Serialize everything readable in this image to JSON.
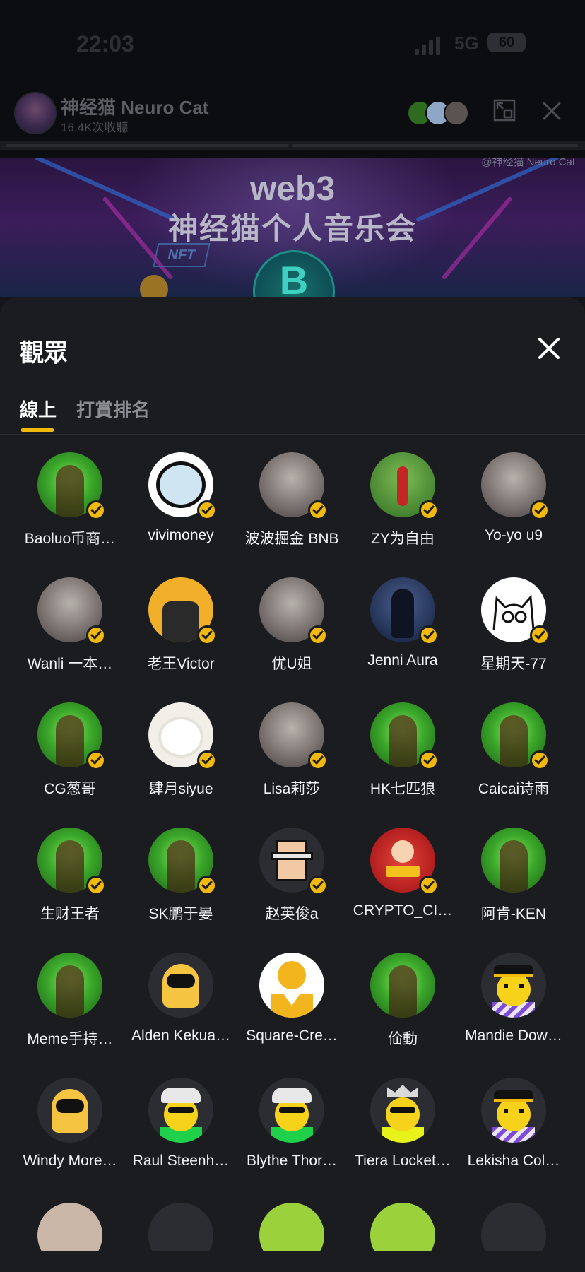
{
  "status_bar": {
    "time": "22:03",
    "network": "5G",
    "battery": "60"
  },
  "room": {
    "title": "神经猫 Neuro Cat",
    "subtitle": "16.4K次收聽",
    "banner_line1": "web3",
    "banner_line2": "神经猫个人音乐会",
    "banner_watermark": "@神经猫 Neuro Cat",
    "banner_badge": "NFT",
    "banner_coin": "B"
  },
  "sheet": {
    "title": "觀眾",
    "tabs": [
      {
        "label": "線上",
        "active": true
      },
      {
        "label": "打賞排名",
        "active": false
      }
    ],
    "accent_color": "#f0b90b"
  },
  "audience": [
    {
      "name": "Baoluo币商…",
      "avatar": "hood-avatar",
      "verified": true
    },
    {
      "name": "vivimoney",
      "avatar": "white-dog-avatar",
      "verified": true
    },
    {
      "name": "波波掘金 BNB",
      "avatar": "photo-avatar",
      "verified": true
    },
    {
      "name": "ZY为自由",
      "avatar": "football-avatar",
      "verified": true
    },
    {
      "name": "Yo-yo u9",
      "avatar": "photo-avatar",
      "verified": true
    },
    {
      "name": "Wanli 一本…",
      "avatar": "photo-avatar",
      "verified": true
    },
    {
      "name": "老王Victor",
      "avatar": "bnb-chain-avatar",
      "verified": true
    },
    {
      "name": "优U姐",
      "avatar": "photo-avatar",
      "verified": true
    },
    {
      "name": "Jenni Aura",
      "avatar": "cyber-girl-avatar",
      "verified": true
    },
    {
      "name": "星期天-77",
      "avatar": "cat-doodle-avatar",
      "verified": true
    },
    {
      "name": "CG葱哥",
      "avatar": "hood-avatar",
      "verified": true
    },
    {
      "name": "肆月siyue",
      "avatar": "white-cat-avatar",
      "verified": true
    },
    {
      "name": "Lisa莉莎",
      "avatar": "photo-avatar",
      "verified": true
    },
    {
      "name": "HK七匹狼",
      "avatar": "hood-avatar",
      "verified": true
    },
    {
      "name": "Caicai诗雨",
      "avatar": "hood-avatar",
      "verified": true
    },
    {
      "name": "生财王者",
      "avatar": "hood-avatar",
      "verified": true
    },
    {
      "name": "SK鹏于晏",
      "avatar": "hood-avatar",
      "verified": true
    },
    {
      "name": "赵英俊a",
      "avatar": "pixel-punk-avatar",
      "verified": true
    },
    {
      "name": "CRYPTO_CI…",
      "avatar": "crypto-citizen-avatar",
      "verified": true
    },
    {
      "name": "阿肯-KEN",
      "avatar": "hood-avatar",
      "verified": false
    },
    {
      "name": "Meme手持…",
      "avatar": "hood-avatar",
      "verified": false
    },
    {
      "name": "Alden Kekua…",
      "avatar": "astronaut-avatar",
      "verified": false
    },
    {
      "name": "Square-Cre…",
      "avatar": "square-creator-avatar",
      "verified": false
    },
    {
      "name": "佡動",
      "avatar": "hood-avatar",
      "verified": false
    },
    {
      "name": "Mandie Dow…",
      "avatar": "smiley-hat-avatar",
      "verified": false
    },
    {
      "name": "Windy More…",
      "avatar": "astronaut-avatar",
      "verified": false
    },
    {
      "name": "Raul Steenh…",
      "avatar": "smiley-shades-avatar",
      "verified": false
    },
    {
      "name": "Blythe Thor…",
      "avatar": "smiley-shades-avatar",
      "verified": false
    },
    {
      "name": "Tiera Locket…",
      "avatar": "smiley-crown-avatar",
      "verified": false
    },
    {
      "name": "Lekisha Col…",
      "avatar": "smiley-hat-avatar",
      "verified": false
    }
  ]
}
